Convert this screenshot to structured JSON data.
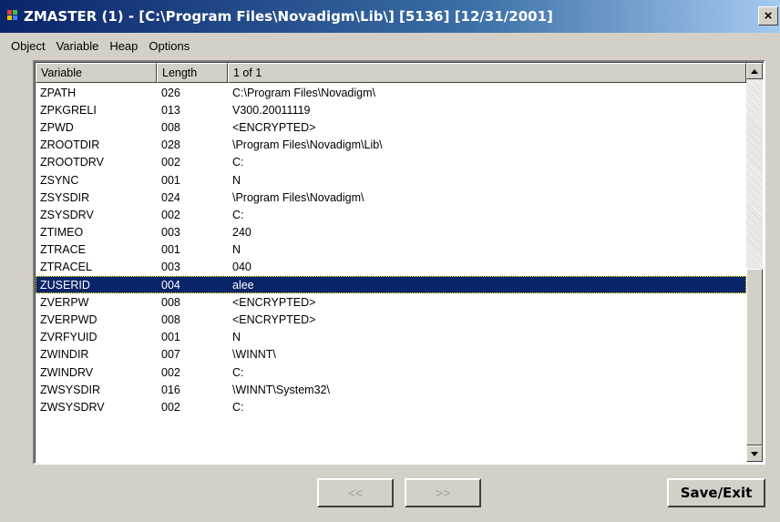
{
  "window": {
    "title": "ZMASTER (1) - [C:\\Program Files\\Novadigm\\Lib\\] [5136] [12/31/2001]",
    "close_glyph": "×"
  },
  "menu": [
    "Object",
    "Variable",
    "Heap",
    "Options"
  ],
  "list": {
    "columns": [
      "Variable",
      "Length",
      "1 of 1"
    ],
    "rows": [
      {
        "variable": "ZPATH",
        "length": "026",
        "data": "C:\\Program Files\\Novadigm\\"
      },
      {
        "variable": "ZPKGRELI",
        "length": "013",
        "data": "V300.20011119"
      },
      {
        "variable": "ZPWD",
        "length": "008",
        "data": "<ENCRYPTED>"
      },
      {
        "variable": "ZROOTDIR",
        "length": "028",
        "data": "\\Program Files\\Novadigm\\Lib\\"
      },
      {
        "variable": "ZROOTDRV",
        "length": "002",
        "data": "C:"
      },
      {
        "variable": "ZSYNC",
        "length": "001",
        "data": "N"
      },
      {
        "variable": "ZSYSDIR",
        "length": "024",
        "data": "\\Program Files\\Novadigm\\"
      },
      {
        "variable": "ZSYSDRV",
        "length": "002",
        "data": "C:"
      },
      {
        "variable": "ZTIMEO",
        "length": "003",
        "data": "240"
      },
      {
        "variable": "ZTRACE",
        "length": "001",
        "data": "N"
      },
      {
        "variable": "ZTRACEL",
        "length": "003",
        "data": "040"
      },
      {
        "variable": "ZUSERID",
        "length": "004",
        "data": "alee"
      },
      {
        "variable": "ZVERPW",
        "length": "008",
        "data": "<ENCRYPTED>"
      },
      {
        "variable": "ZVERPWD",
        "length": "008",
        "data": "<ENCRYPTED>"
      },
      {
        "variable": "ZVRFYUID",
        "length": "001",
        "data": "N"
      },
      {
        "variable": "ZWINDIR",
        "length": "007",
        "data": "\\WINNT\\"
      },
      {
        "variable": "ZWINDRV",
        "length": "002",
        "data": "C:"
      },
      {
        "variable": "ZWSYSDIR",
        "length": "016",
        "data": "\\WINNT\\System32\\"
      },
      {
        "variable": "ZWSYSDRV",
        "length": "002",
        "data": "C:"
      }
    ],
    "selected_index": 11
  },
  "buttons": {
    "prev": "<<",
    "next": ">>",
    "save_exit": "Save/Exit"
  }
}
